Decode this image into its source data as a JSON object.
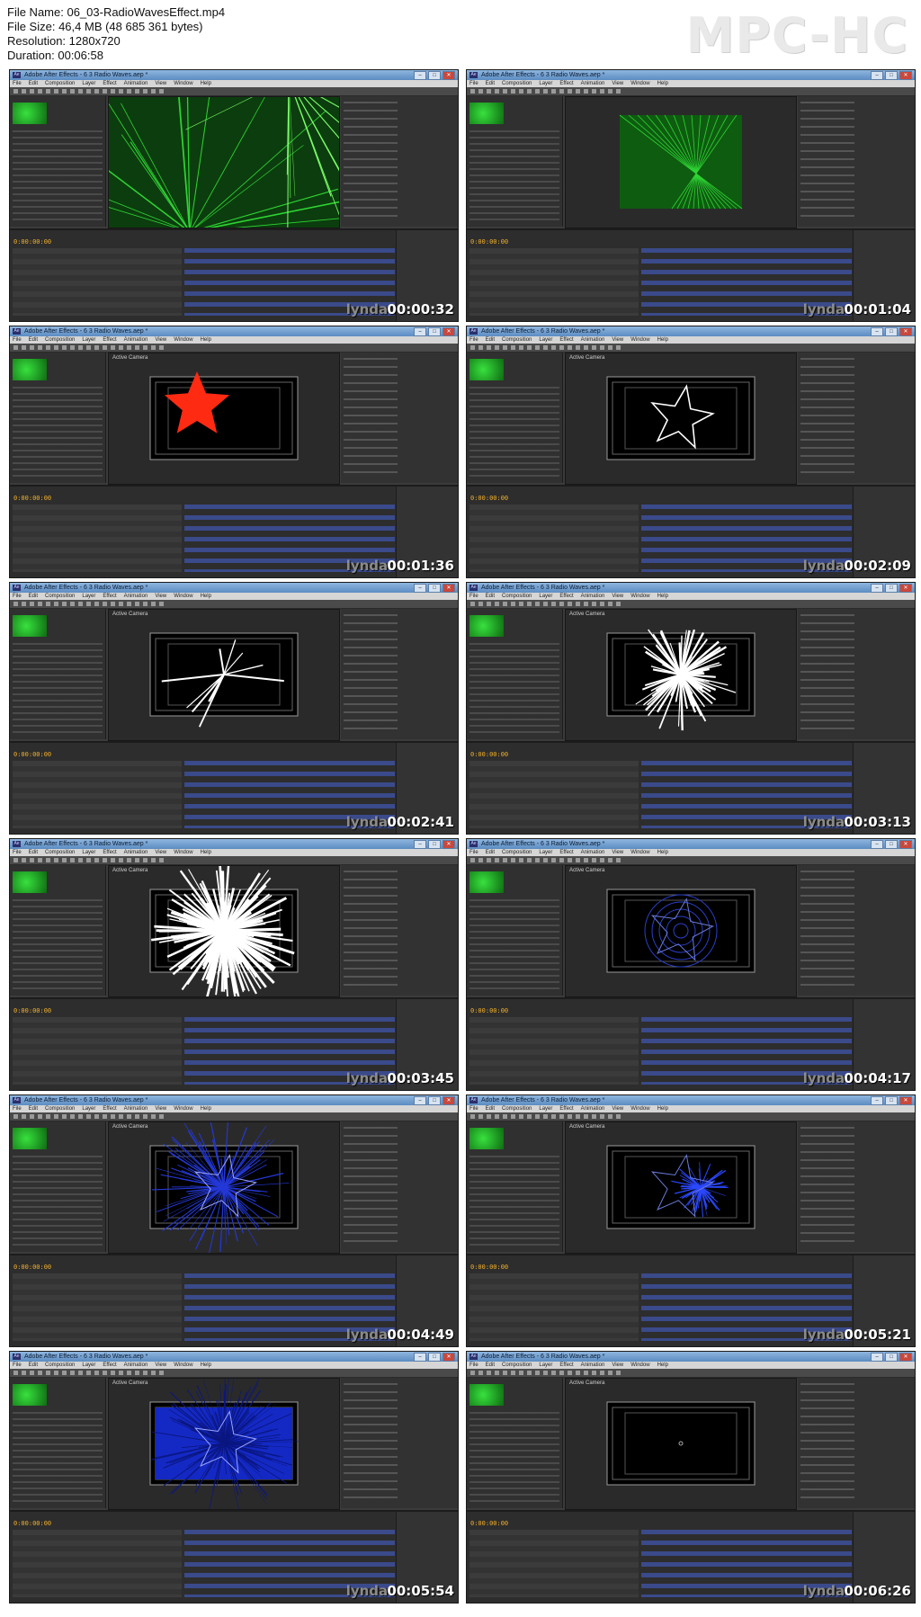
{
  "header": {
    "file_name": "File Name: 06_03-RadioWavesEffect.mp4",
    "file_size": "File Size: 46,4 MB (48 685 361 bytes)",
    "resolution": "Resolution: 1280x720",
    "duration": "Duration: 00:06:58"
  },
  "brand": "MPC-HC",
  "app": {
    "window_title": "Adobe After Effects - 6 3 Radio Waves.aep *",
    "app_icon": "Ae",
    "menu": [
      "File",
      "Edit",
      "Composition",
      "Layer",
      "Effect",
      "Animation",
      "View",
      "Window",
      "Help"
    ],
    "viewer_label": "Active Camera",
    "timecode": "0:00:00:00",
    "watermark": "lynda"
  },
  "thumbnails": [
    {
      "time": "00:00:32",
      "scene": "green-waves-full"
    },
    {
      "time": "00:01:04",
      "scene": "green-grid"
    },
    {
      "time": "00:01:36",
      "scene": "red-star"
    },
    {
      "time": "00:02:09",
      "scene": "white-star-outline"
    },
    {
      "time": "00:02:41",
      "scene": "starburst-sparse"
    },
    {
      "time": "00:03:13",
      "scene": "starburst-medium"
    },
    {
      "time": "00:03:45",
      "scene": "starburst-dense"
    },
    {
      "time": "00:04:17",
      "scene": "blue-rings"
    },
    {
      "time": "00:04:49",
      "scene": "blue-lines"
    },
    {
      "time": "00:05:21",
      "scene": "blue-star-center"
    },
    {
      "time": "00:05:54",
      "scene": "blue-dense"
    },
    {
      "time": "00:06:26",
      "scene": "black-empty"
    }
  ],
  "colors": {
    "accent_orange": "#f3b12a",
    "ae_blue": "#3a4a8a",
    "green": "#2fd434",
    "red": "#ff2a12",
    "blue": "#1f3cff"
  }
}
